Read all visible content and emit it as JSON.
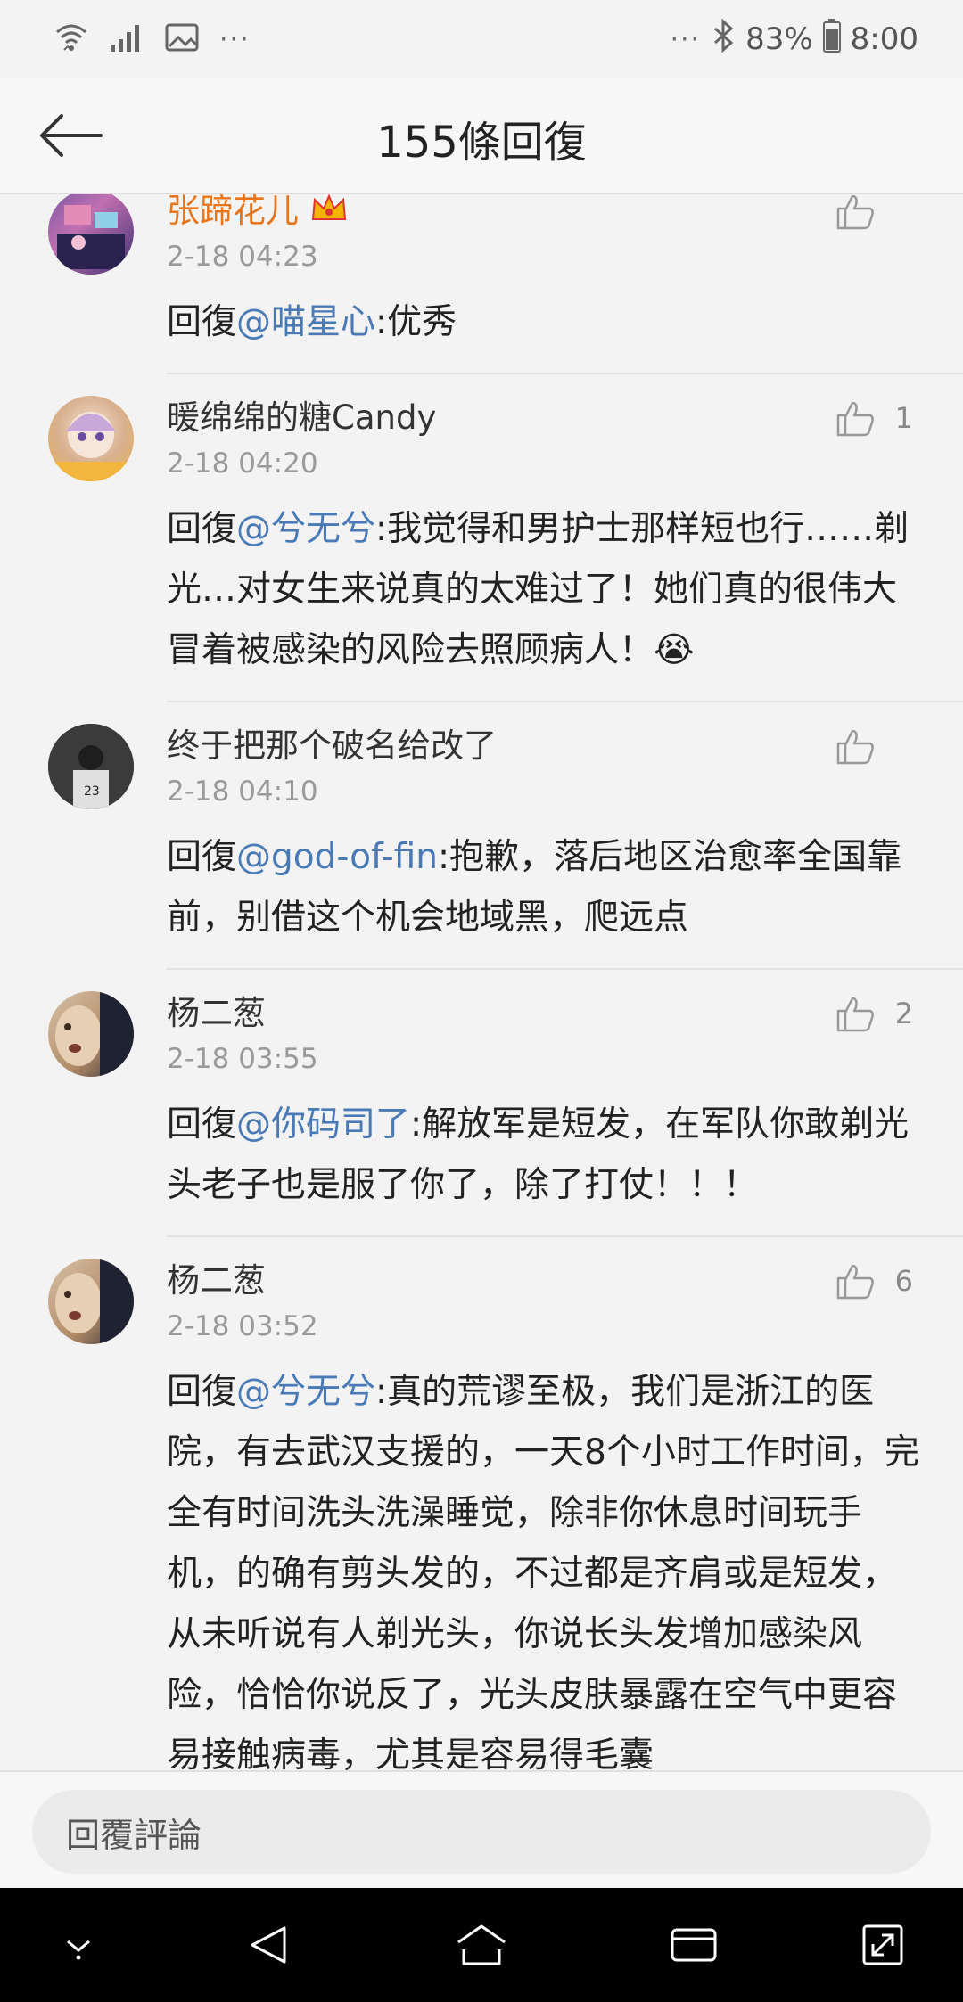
{
  "status_bar": {
    "left_dots": "···",
    "right_dots": "···",
    "battery": "83%",
    "time": "8:00"
  },
  "header": {
    "title": "155條回復"
  },
  "comments": [
    {
      "username": "张蹄花儿",
      "time": "2-18 04:23",
      "reply_prefix": "回復",
      "mention": "@喵星心",
      "text": ":优秀",
      "likes": ""
    },
    {
      "username": "暖绵绵的糖Candy",
      "time": "2-18 04:20",
      "reply_prefix": "回復",
      "mention": "@兮无兮",
      "text": ":我觉得和男护士那样短也行……剃光…对女生来说真的太难过了！她们真的很伟大冒着被感染的风险去照顾病人！",
      "emoji": "😭",
      "likes": "1"
    },
    {
      "username": "终于把那个破名给改了",
      "time": "2-18 04:10",
      "reply_prefix": "回復",
      "mention": "@god-of-fin",
      "text": ":抱歉，落后地区治愈率全国靠前，别借这个机会地域黑，爬远点",
      "likes": ""
    },
    {
      "username": "杨二葱",
      "time": "2-18 03:55",
      "reply_prefix": "回復",
      "mention": "@你码司了",
      "text": ":解放军是短发，在军队你敢剃光头老子也是服了你了，除了打仗！！！",
      "likes": "2"
    },
    {
      "username": "杨二葱",
      "time": "2-18 03:52",
      "reply_prefix": "回復",
      "mention": "@兮无兮",
      "text": ":真的荒谬至极，我们是浙江的医院，有去武汉支援的，一天8个小时工作时间，完全有时间洗头洗澡睡觉，除非你休息时间玩手机，的确有剪头发的，不过都是齐肩或是短发，从未听说有人剃光头，你说长头发增加感染风险，恰恰你说反了，光头皮肤暴露在空气中更容易接触病毒，尤其是容易得毛囊",
      "likes": "6"
    }
  ],
  "reply_bar": {
    "placeholder": "回覆評論"
  },
  "colors": {
    "mention": "#4a7ab5",
    "vip_name": "#e8751a",
    "background": "#f3f3f3"
  }
}
